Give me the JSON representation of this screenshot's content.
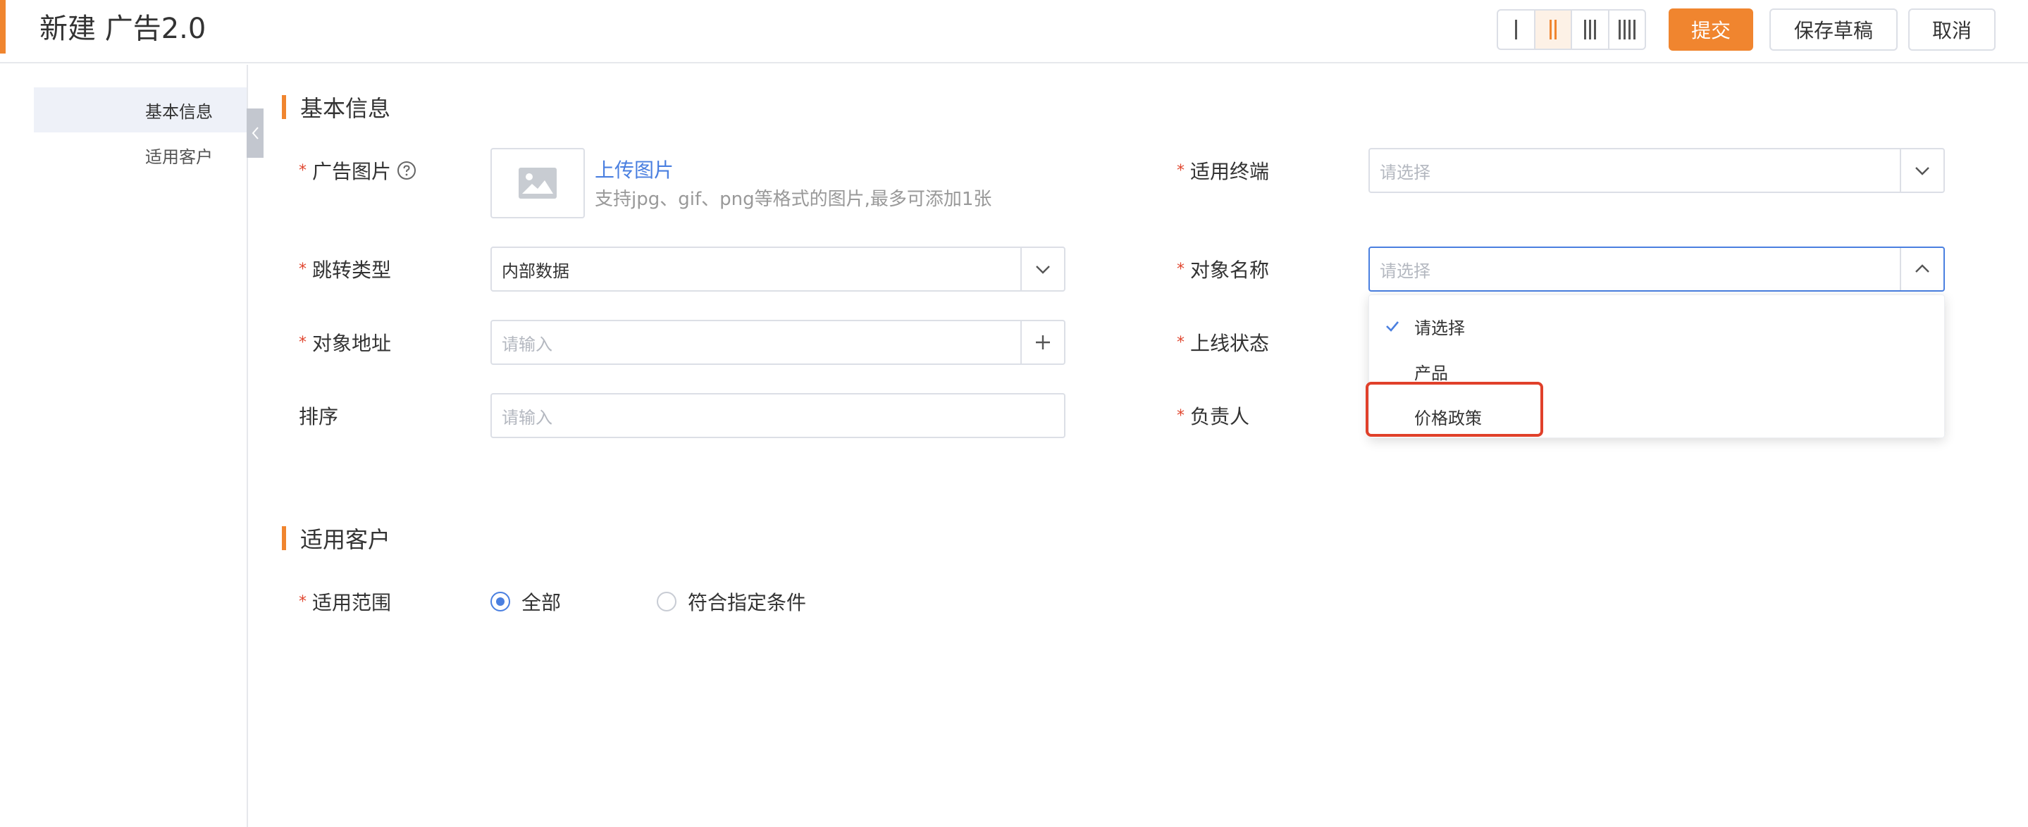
{
  "header": {
    "title": "新建 广告2.0",
    "submit_label": "提交",
    "save_draft_label": "保存草稿",
    "cancel_label": "取消",
    "layout_active_index": 1
  },
  "sidebar": {
    "items": [
      {
        "label": "基本信息",
        "active": true
      },
      {
        "label": "适用客户",
        "active": false
      }
    ]
  },
  "basic_section": {
    "title": "基本信息",
    "ad_image": {
      "label": "广告图片",
      "upload_link": "上传图片",
      "hint": "支持jpg、gif、png等格式的图片,最多可添加1张"
    },
    "jump_type": {
      "label": "跳转类型",
      "value": "内部数据"
    },
    "object_address": {
      "label": "对象地址",
      "placeholder": "请输入"
    },
    "sort": {
      "label": "排序",
      "placeholder": "请输入"
    },
    "terminal": {
      "label": "适用终端",
      "placeholder": "请选择"
    },
    "object_name": {
      "label": "对象名称",
      "placeholder": "请选择"
    },
    "online_status": {
      "label": "上线状态"
    },
    "owner": {
      "label": "负责人"
    }
  },
  "object_name_dropdown": {
    "options": [
      {
        "label": "请选择",
        "selected": true
      },
      {
        "label": "产品",
        "selected": false
      },
      {
        "label": "价格政策",
        "selected": false,
        "highlighted": true
      }
    ]
  },
  "customer_section": {
    "title": "适用客户",
    "scope": {
      "label": "适用范围",
      "options": [
        {
          "label": "全部",
          "checked": true
        },
        {
          "label": "符合指定条件",
          "checked": false
        }
      ]
    }
  },
  "colors": {
    "accent": "#f0852f",
    "link": "#4a7fe0",
    "required": "#e0462f",
    "highlight": "#e0402a"
  }
}
